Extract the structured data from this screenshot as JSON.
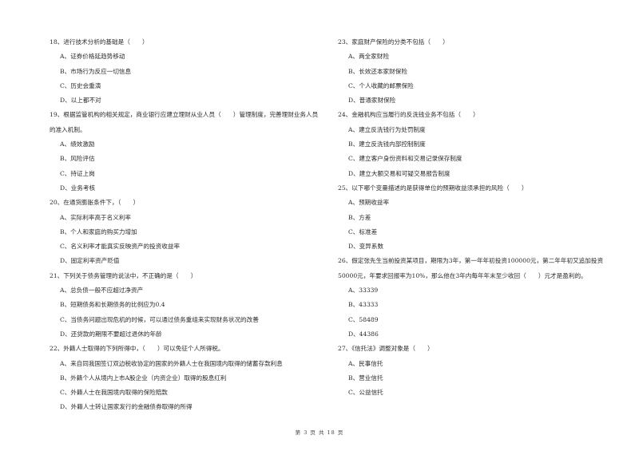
{
  "left_column": [
    {
      "number": "18",
      "stem": "18、进行技术分析的基础是（　　）",
      "options": [
        "A、证券价格延趋势移动",
        "B、市场行为反应一切信息",
        "C、历史会重演",
        "D、以上都不对"
      ]
    },
    {
      "number": "19",
      "stem": "19、根据监管机构的相关规定，商业银行应建立理财从业人员（　　）管理制度，完善理财业务人员的准入机制。",
      "options": [
        "A、绩效激励",
        "B、风险评估",
        "C、持证上岗",
        "D、业务考核"
      ]
    },
    {
      "number": "20",
      "stem": "20、在通货膨胀条件下，（　　）",
      "options": [
        "A、实际利率高于名义利率",
        "B、个人和家庭的购买力增加",
        "C、名义利率才能真实反映资产的投资收益率",
        "D、固定利率资产贬值"
      ]
    },
    {
      "number": "21",
      "stem": "21、下列关于债务管理的说法中，不正确的是（　　）",
      "options": [
        "A、总负债一般不应超过净资产",
        "B、短期债务和长期债务的比例应为0.4",
        "C、当债务问题出现危机的时候，可以通过债务重组来实现财务状况的改善",
        "D、还贷款的期限不要超过退休的年龄"
      ]
    },
    {
      "number": "22",
      "stem": "22、外籍人士取得的下列所得中，（　　）可以免征个人所得税。",
      "options": [
        "A、来自同我国签订双边税收协定的国家的外籍人士在我国境内取得的储蓄存款利息",
        "B、外籍个人从境内上市A股企业（内资企业）取得的股息红利",
        "C、外籍人士在我国境内取得的保险赔款",
        "D、外籍人士转让国家发行的金融债券取得的所得"
      ]
    }
  ],
  "right_column": [
    {
      "number": "23",
      "stem": "23、家庭财产保险的分类不包括（　　）",
      "options": [
        "A、两全家财险",
        "B、长效还本家财保险",
        "C、个人收藏的邮票保险",
        "D、普通家财保险"
      ]
    },
    {
      "number": "24",
      "stem": "24、金融机构应当履行的反洗钱业务不包括（　　）",
      "options": [
        "A、建立反洗钱行为处罚制度",
        "B、建立反洗钱内部控制制度",
        "C、建立客户身份资料和交易记录保存制度",
        "D、建立大额交易和可疑交易报告制度"
      ]
    },
    {
      "number": "25",
      "stem": "25、以下哪个变量描述的是获得单位的预期收益须承担的风险（　　）",
      "options": [
        "A、预期收益率",
        "B、方差",
        "C、标准差",
        "D、变异系数"
      ]
    },
    {
      "number": "26",
      "stem": "26、假定张先生当前投资某项目，期限为3年，第一年年初投资100000元，第二年年初又追加投资50000元，年要求回报率为10%，那么他在3年内每年年末至少收回（　　）元才是盈利的。",
      "options": [
        "A、33339",
        "B、43333",
        "C、58489",
        "D、44386"
      ]
    },
    {
      "number": "27",
      "stem": "27、《信托法》调整对象是（　　）",
      "options": [
        "A、民事信托",
        "B、营业信托",
        "C、公益信托"
      ]
    }
  ],
  "footer": {
    "page_label": "第 3 页 共 18 页"
  }
}
